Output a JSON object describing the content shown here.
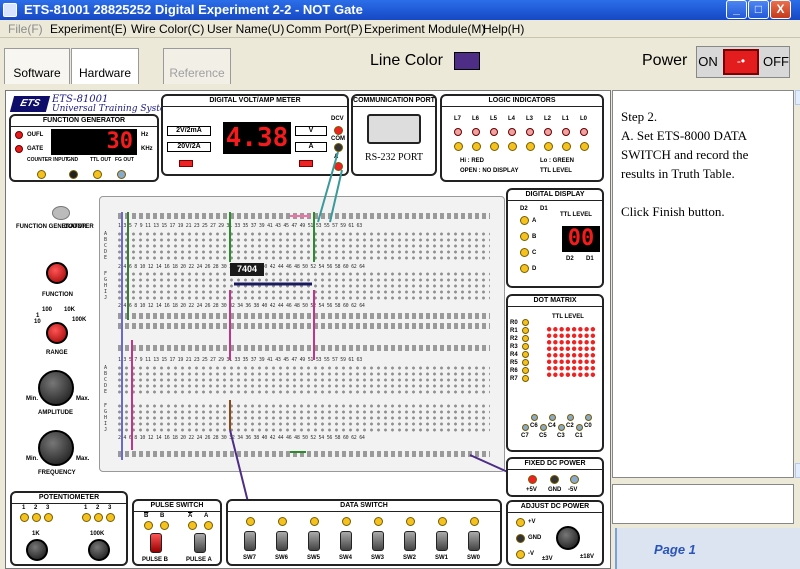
{
  "window": {
    "title": "ETS-81001  28825252    Digital Experiment 2-2 - NOT Gate",
    "minimize": "_",
    "maximize": "□",
    "close": "X"
  },
  "menu": [
    "File(F)",
    "Experiment(E)",
    "Wire Color(C)",
    "User Name(U)",
    "Comm Port(P)",
    "Experiment Module(M)",
    "Help(H)"
  ],
  "tabs": [
    "Software",
    "Hardware",
    "Reference"
  ],
  "line_color": {
    "label": "Line Color",
    "value": "#4d2d85"
  },
  "power": {
    "label": "Power",
    "on": "ON",
    "off": "OFF"
  },
  "logo": {
    "mark": "ETS",
    "model": "ETS-81001",
    "subtitle": "Universal Training System"
  },
  "fg": {
    "title": "FUNCTION GENERATOR",
    "ouflabel": "OUFL",
    "gatelabel": "GATE",
    "display": "30",
    "hz": "Hz",
    "khz": "KHz",
    "jacks": [
      "COUNTER INPUT",
      "GND",
      "TTL OUT",
      "FG OUT"
    ],
    "counter": "COUNTER",
    "function_generator": "FUNCTION GENERATOR",
    "function": "FUNCTION",
    "range": "RANGE",
    "range_marks": [
      "1",
      "10",
      "100",
      "10K",
      "100K"
    ],
    "amplitude": "AMPLITUDE",
    "frequency": "FREQUENCY",
    "min": "Min.",
    "max": "Max."
  },
  "dvm": {
    "title": "DIGITAL VOLT/AMP METER",
    "ranges": [
      "2V/2mA",
      "20V/2A"
    ],
    "display": "4.38",
    "dcv": "DCV",
    "com": "COM",
    "a": "A",
    "v": "V",
    "aa": "A"
  },
  "comm": {
    "title": "COMMUNICATION PORT",
    "label": "RS-232 PORT"
  },
  "logic": {
    "title": "LOGIC INDICATORS",
    "labels": [
      "L7",
      "L6",
      "L5",
      "L4",
      "L3",
      "L2",
      "L1",
      "L0"
    ],
    "hi": "Hi : RED",
    "lo": "Lo : GREEN",
    "open": "OPEN : NO DISPLAY",
    "ttl": "TTL LEVEL"
  },
  "dd": {
    "title": "DIGITAL DISPLAY",
    "d2": "D2",
    "d1": "D1",
    "ttl": "TTL LEVEL",
    "letters": [
      "A",
      "B",
      "C",
      "D"
    ],
    "display": "00",
    "dl2": "D2",
    "dl1": "D1"
  },
  "dm": {
    "title": "DOT MATRIX",
    "ttl": "TTL LEVEL",
    "rows": [
      "R0",
      "R1",
      "R2",
      "R3",
      "R4",
      "R5",
      "R6",
      "R7"
    ],
    "cols": [
      "C7",
      "C6",
      "C5",
      "C4",
      "C3",
      "C2",
      "C1",
      "C0"
    ]
  },
  "board": {
    "chip": "7404",
    "rowletters_top": "A B C D E",
    "rowletters_bot": "F G H I J",
    "numbers": "1  3  5  7  9  11  13  15  17  19  21  23  25  27  29  31  33  35  37  39  41  43  45  47  49  51  53  55  57  59  61  63",
    "numbers_even": "2  4  6  8  10  12  14  16  18  20  22  24  26  28  30  32  34  36  38  40  42  44  46  48  50  52  54  56  58  60  62  64"
  },
  "fixed_power": {
    "title": "FIXED DC POWER",
    "labels": [
      "+5V",
      "GND",
      "-5V"
    ]
  },
  "adjust_power": {
    "title": "ADJUST DC POWER",
    "labels": [
      "+V",
      "GND",
      "-V"
    ],
    "v1": "±3V",
    "v2": "±18V"
  },
  "pot": {
    "title": "POTENTIOMETER",
    "labels": [
      "1K",
      "100K"
    ],
    "pins": [
      "1",
      "2",
      "3",
      "1",
      "2",
      "3"
    ]
  },
  "pulse": {
    "title": "PULSE SWITCH",
    "labels": [
      "B",
      "B",
      "A",
      "A"
    ],
    "bottom": [
      "PULSE B",
      "PULSE A"
    ]
  },
  "data_switch": {
    "title": "DATA SWITCH",
    "labels": [
      "SW7",
      "SW6",
      "SW5",
      "SW4",
      "SW3",
      "SW2",
      "SW1",
      "SW0"
    ]
  },
  "instructions": "Step 2.\nA. Set ETS-8000 DATA SWITCH and record the results in Truth Table.\n\nClick Finish button.",
  "page": "Page 1"
}
